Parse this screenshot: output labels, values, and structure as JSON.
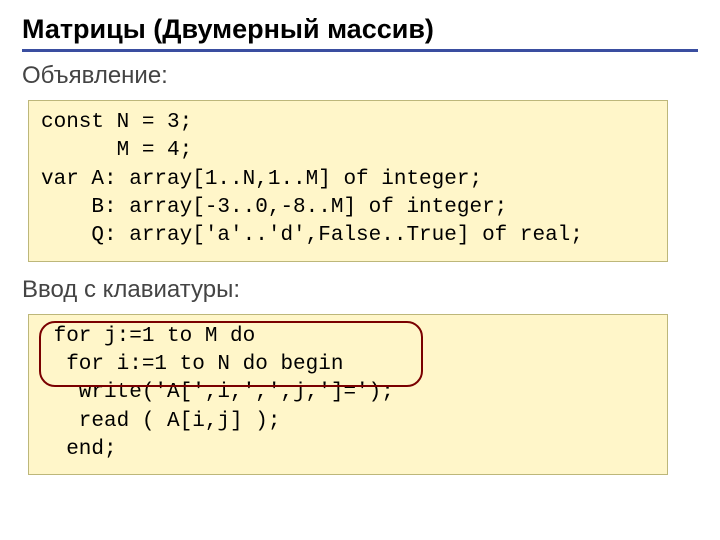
{
  "title": "Матрицы (Двумерный массив)",
  "sub1": "Объявление:",
  "code1": {
    "l1": "const N = 3;",
    "l2": "      M = 4;",
    "l3": "var A: array[1..N,1..M] of integer;",
    "l4": "    B: array[-3..0,-8..M] of integer;",
    "l5": "    Q: array['a'..'d',False..True] of real;"
  },
  "sub2": "Ввод с клавиатуры:",
  "code2": {
    "l1": " for j:=1 to M do",
    "l2": "  for i:=1 to N do begin",
    "l3": "   write('A[',i,',',j,']=');",
    "l4": "   read ( A[i,j] );",
    "l5": "  end;"
  }
}
